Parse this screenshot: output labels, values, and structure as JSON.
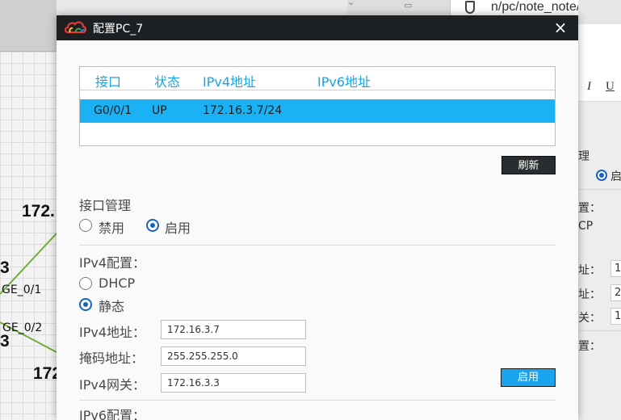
{
  "background": {
    "topology_labels": {
      "label_a": "172.",
      "label_b": "3",
      "port_1": "GE_0/1",
      "port_2": "GE_0/2",
      "label_c": "3",
      "label_d": "172"
    },
    "browser": {
      "url": "n/pc/note_note/no"
    },
    "editor": {
      "italic": "I",
      "underline": "U"
    },
    "side_panel": {
      "texts": [
        "理",
        "启",
        "置：",
        "CP",
        "址：",
        "址：",
        "关：",
        "置："
      ],
      "boxes": [
        "1",
        "2",
        "1"
      ]
    }
  },
  "dialog": {
    "title": "配置PC_7",
    "close_glyph": "×",
    "table": {
      "headers": [
        "接口",
        "状态",
        "IPv4地址",
        "IPv6地址"
      ],
      "rows": [
        [
          "G0/0/1",
          "UP",
          "172.16.3.7/24",
          ""
        ]
      ]
    },
    "refresh_button": "刷新",
    "interface_mgmt": {
      "label": "接口管理",
      "disable": "禁用",
      "enable": "启用"
    },
    "ipv4": {
      "label": "IPv4配置：",
      "dhcp": "DHCP",
      "static": "静态",
      "address_label": "IPv4地址：",
      "address_value": "172.16.3.7",
      "mask_label": "掩码地址：",
      "mask_value": "255.255.255.0",
      "gateway_label": "IPv4网关：",
      "gateway_value": "172.16.3.3",
      "apply_button": "启用"
    },
    "ipv6": {
      "label": "IPv6配置："
    }
  }
}
